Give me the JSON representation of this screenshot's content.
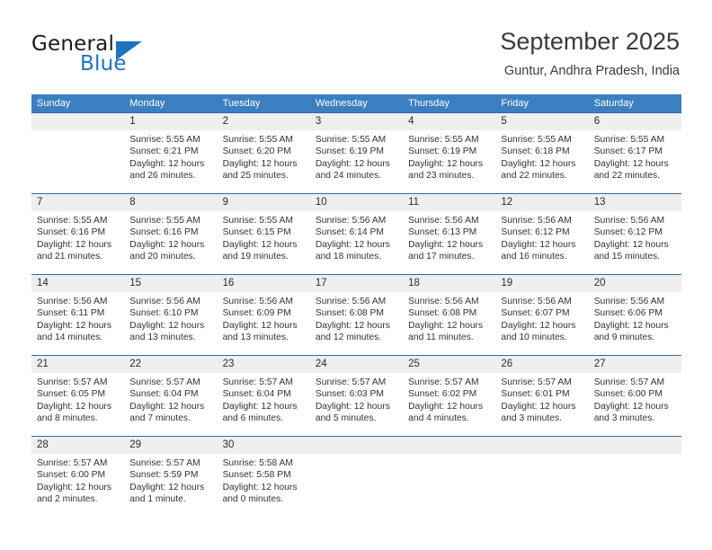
{
  "brand": {
    "name_top": "General",
    "name_bottom": "Blue",
    "accent_color": "#1f73bd"
  },
  "header": {
    "title": "September 2025",
    "subtitle": "Guntur, Andhra Pradesh, India"
  },
  "theme": {
    "header_row_bg": "#3c7fc1",
    "week_divider": "#2e6da8",
    "day_band_bg": "#efefef",
    "text_color": "#333333"
  },
  "weekdays": [
    "Sunday",
    "Monday",
    "Tuesday",
    "Wednesday",
    "Thursday",
    "Friday",
    "Saturday"
  ],
  "labels": {
    "sunrise": "Sunrise:",
    "sunset": "Sunset:",
    "daylight": "Daylight:"
  },
  "weeks": [
    {
      "days": [
        {
          "number": "",
          "empty": true,
          "sunrise": "",
          "sunset": "",
          "daylight_1": "",
          "daylight_2": ""
        },
        {
          "number": "1",
          "empty": false,
          "sunrise": "Sunrise: 5:55 AM",
          "sunset": "Sunset: 6:21 PM",
          "daylight_1": "Daylight: 12 hours",
          "daylight_2": "and 26 minutes."
        },
        {
          "number": "2",
          "empty": false,
          "sunrise": "Sunrise: 5:55 AM",
          "sunset": "Sunset: 6:20 PM",
          "daylight_1": "Daylight: 12 hours",
          "daylight_2": "and 25 minutes."
        },
        {
          "number": "3",
          "empty": false,
          "sunrise": "Sunrise: 5:55 AM",
          "sunset": "Sunset: 6:19 PM",
          "daylight_1": "Daylight: 12 hours",
          "daylight_2": "and 24 minutes."
        },
        {
          "number": "4",
          "empty": false,
          "sunrise": "Sunrise: 5:55 AM",
          "sunset": "Sunset: 6:19 PM",
          "daylight_1": "Daylight: 12 hours",
          "daylight_2": "and 23 minutes."
        },
        {
          "number": "5",
          "empty": false,
          "sunrise": "Sunrise: 5:55 AM",
          "sunset": "Sunset: 6:18 PM",
          "daylight_1": "Daylight: 12 hours",
          "daylight_2": "and 22 minutes."
        },
        {
          "number": "6",
          "empty": false,
          "sunrise": "Sunrise: 5:55 AM",
          "sunset": "Sunset: 6:17 PM",
          "daylight_1": "Daylight: 12 hours",
          "daylight_2": "and 22 minutes."
        }
      ]
    },
    {
      "days": [
        {
          "number": "7",
          "empty": false,
          "sunrise": "Sunrise: 5:55 AM",
          "sunset": "Sunset: 6:16 PM",
          "daylight_1": "Daylight: 12 hours",
          "daylight_2": "and 21 minutes."
        },
        {
          "number": "8",
          "empty": false,
          "sunrise": "Sunrise: 5:55 AM",
          "sunset": "Sunset: 6:16 PM",
          "daylight_1": "Daylight: 12 hours",
          "daylight_2": "and 20 minutes."
        },
        {
          "number": "9",
          "empty": false,
          "sunrise": "Sunrise: 5:55 AM",
          "sunset": "Sunset: 6:15 PM",
          "daylight_1": "Daylight: 12 hours",
          "daylight_2": "and 19 minutes."
        },
        {
          "number": "10",
          "empty": false,
          "sunrise": "Sunrise: 5:56 AM",
          "sunset": "Sunset: 6:14 PM",
          "daylight_1": "Daylight: 12 hours",
          "daylight_2": "and 18 minutes."
        },
        {
          "number": "11",
          "empty": false,
          "sunrise": "Sunrise: 5:56 AM",
          "sunset": "Sunset: 6:13 PM",
          "daylight_1": "Daylight: 12 hours",
          "daylight_2": "and 17 minutes."
        },
        {
          "number": "12",
          "empty": false,
          "sunrise": "Sunrise: 5:56 AM",
          "sunset": "Sunset: 6:12 PM",
          "daylight_1": "Daylight: 12 hours",
          "daylight_2": "and 16 minutes."
        },
        {
          "number": "13",
          "empty": false,
          "sunrise": "Sunrise: 5:56 AM",
          "sunset": "Sunset: 6:12 PM",
          "daylight_1": "Daylight: 12 hours",
          "daylight_2": "and 15 minutes."
        }
      ]
    },
    {
      "days": [
        {
          "number": "14",
          "empty": false,
          "sunrise": "Sunrise: 5:56 AM",
          "sunset": "Sunset: 6:11 PM",
          "daylight_1": "Daylight: 12 hours",
          "daylight_2": "and 14 minutes."
        },
        {
          "number": "15",
          "empty": false,
          "sunrise": "Sunrise: 5:56 AM",
          "sunset": "Sunset: 6:10 PM",
          "daylight_1": "Daylight: 12 hours",
          "daylight_2": "and 13 minutes."
        },
        {
          "number": "16",
          "empty": false,
          "sunrise": "Sunrise: 5:56 AM",
          "sunset": "Sunset: 6:09 PM",
          "daylight_1": "Daylight: 12 hours",
          "daylight_2": "and 13 minutes."
        },
        {
          "number": "17",
          "empty": false,
          "sunrise": "Sunrise: 5:56 AM",
          "sunset": "Sunset: 6:08 PM",
          "daylight_1": "Daylight: 12 hours",
          "daylight_2": "and 12 minutes."
        },
        {
          "number": "18",
          "empty": false,
          "sunrise": "Sunrise: 5:56 AM",
          "sunset": "Sunset: 6:08 PM",
          "daylight_1": "Daylight: 12 hours",
          "daylight_2": "and 11 minutes."
        },
        {
          "number": "19",
          "empty": false,
          "sunrise": "Sunrise: 5:56 AM",
          "sunset": "Sunset: 6:07 PM",
          "daylight_1": "Daylight: 12 hours",
          "daylight_2": "and 10 minutes."
        },
        {
          "number": "20",
          "empty": false,
          "sunrise": "Sunrise: 5:56 AM",
          "sunset": "Sunset: 6:06 PM",
          "daylight_1": "Daylight: 12 hours",
          "daylight_2": "and 9 minutes."
        }
      ]
    },
    {
      "days": [
        {
          "number": "21",
          "empty": false,
          "sunrise": "Sunrise: 5:57 AM",
          "sunset": "Sunset: 6:05 PM",
          "daylight_1": "Daylight: 12 hours",
          "daylight_2": "and 8 minutes."
        },
        {
          "number": "22",
          "empty": false,
          "sunrise": "Sunrise: 5:57 AM",
          "sunset": "Sunset: 6:04 PM",
          "daylight_1": "Daylight: 12 hours",
          "daylight_2": "and 7 minutes."
        },
        {
          "number": "23",
          "empty": false,
          "sunrise": "Sunrise: 5:57 AM",
          "sunset": "Sunset: 6:04 PM",
          "daylight_1": "Daylight: 12 hours",
          "daylight_2": "and 6 minutes."
        },
        {
          "number": "24",
          "empty": false,
          "sunrise": "Sunrise: 5:57 AM",
          "sunset": "Sunset: 6:03 PM",
          "daylight_1": "Daylight: 12 hours",
          "daylight_2": "and 5 minutes."
        },
        {
          "number": "25",
          "empty": false,
          "sunrise": "Sunrise: 5:57 AM",
          "sunset": "Sunset: 6:02 PM",
          "daylight_1": "Daylight: 12 hours",
          "daylight_2": "and 4 minutes."
        },
        {
          "number": "26",
          "empty": false,
          "sunrise": "Sunrise: 5:57 AM",
          "sunset": "Sunset: 6:01 PM",
          "daylight_1": "Daylight: 12 hours",
          "daylight_2": "and 3 minutes."
        },
        {
          "number": "27",
          "empty": false,
          "sunrise": "Sunrise: 5:57 AM",
          "sunset": "Sunset: 6:00 PM",
          "daylight_1": "Daylight: 12 hours",
          "daylight_2": "and 3 minutes."
        }
      ]
    },
    {
      "days": [
        {
          "number": "28",
          "empty": false,
          "sunrise": "Sunrise: 5:57 AM",
          "sunset": "Sunset: 6:00 PM",
          "daylight_1": "Daylight: 12 hours",
          "daylight_2": "and 2 minutes."
        },
        {
          "number": "29",
          "empty": false,
          "sunrise": "Sunrise: 5:57 AM",
          "sunset": "Sunset: 5:59 PM",
          "daylight_1": "Daylight: 12 hours",
          "daylight_2": "and 1 minute."
        },
        {
          "number": "30",
          "empty": false,
          "sunrise": "Sunrise: 5:58 AM",
          "sunset": "Sunset: 5:58 PM",
          "daylight_1": "Daylight: 12 hours",
          "daylight_2": "and 0 minutes."
        },
        {
          "number": "",
          "empty": true,
          "sunrise": "",
          "sunset": "",
          "daylight_1": "",
          "daylight_2": ""
        },
        {
          "number": "",
          "empty": true,
          "sunrise": "",
          "sunset": "",
          "daylight_1": "",
          "daylight_2": ""
        },
        {
          "number": "",
          "empty": true,
          "sunrise": "",
          "sunset": "",
          "daylight_1": "",
          "daylight_2": ""
        },
        {
          "number": "",
          "empty": true,
          "sunrise": "",
          "sunset": "",
          "daylight_1": "",
          "daylight_2": ""
        }
      ]
    }
  ]
}
